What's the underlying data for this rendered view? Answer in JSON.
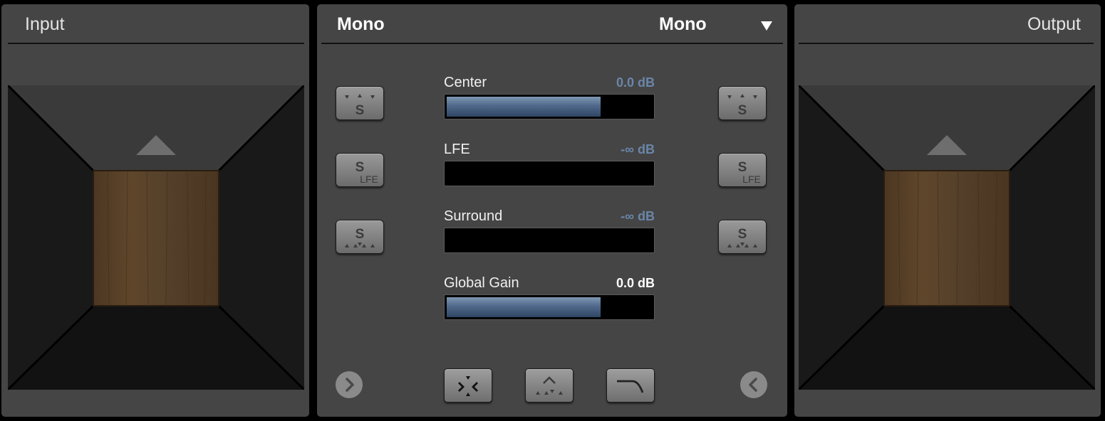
{
  "input_panel": {
    "title": "Input"
  },
  "output_panel": {
    "title": "Output"
  },
  "center_panel": {
    "input_format": "Mono",
    "output_format": "Mono",
    "dropdown_icon": "triangle-down-icon"
  },
  "faders": [
    {
      "label": "Center",
      "value": "0.0 dB",
      "level": 0.75,
      "value_color": "#6a86a8"
    },
    {
      "label": "LFE",
      "value": "-∞ dB",
      "level": 0,
      "value_color": "#6a86a8"
    },
    {
      "label": "Surround",
      "value": "-∞ dB",
      "level": 0,
      "value_color": "#6a86a8"
    },
    {
      "label": "Global Gain",
      "value": "0.0 dB",
      "level": 0.75,
      "value_color": "#ffffff"
    }
  ],
  "side_buttons": {
    "solo_center_icon": "solo-center-icon",
    "solo_lfe_icon": "solo-lfe-icon",
    "solo_surround_icon": "solo-surround-icon",
    "lfe_text": "LFE",
    "s_text": "S"
  },
  "bottom_buttons": [
    "mix-down-icon",
    "center-surround-icon",
    "low-pass-filter-icon"
  ],
  "colors": {
    "panel": "#454545",
    "floor": "#5c4128",
    "fader_fill": "#5f7a9c"
  }
}
